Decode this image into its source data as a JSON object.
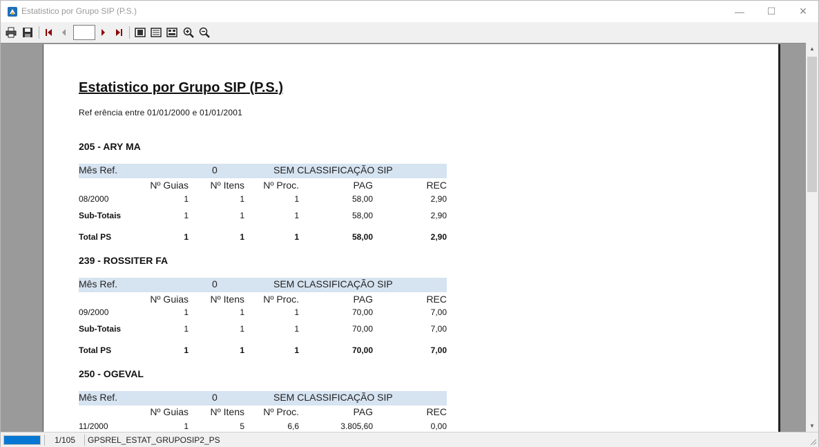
{
  "window": {
    "title": "Estatistico por Grupo SIP (P.S.)",
    "minimize_glyph": "—",
    "maximize_glyph": "☐",
    "close_glyph": "✕"
  },
  "toolbar": {
    "buttons": [
      "print-icon",
      "save-icon",
      "first-page-icon",
      "prev-page-icon",
      "next-page-icon",
      "last-page-icon",
      "whole-page-icon",
      "page-width-icon",
      "multiple-pages-icon",
      "zoom-in-icon",
      "zoom-out-icon"
    ],
    "page_value": ""
  },
  "report": {
    "title": "Estatistico por Grupo SIP (P.S.)",
    "subtitle": "Ref erência entre 01/01/2000 e 01/01/2001",
    "columns": {
      "guias": "Nº Guias",
      "itens": "Nº Itens",
      "proc": "Nº Proc.",
      "pag": "PAG",
      "rec": "REC"
    },
    "groups": [
      {
        "header": "205 - ARY MA",
        "band_label": "Mês Ref.",
        "band_code": "0",
        "band_desc": "SEM CLASSIFICAÇÃO SIP",
        "rows": [
          {
            "label": "08/2000",
            "guias": "1",
            "itens": "1",
            "proc": "1",
            "pag": "58,00",
            "rec": "2,90"
          },
          {
            "label": "Sub-Totais",
            "guias": "1",
            "itens": "1",
            "proc": "1",
            "pag": "58,00",
            "rec": "2,90"
          },
          {
            "label": "Total PS",
            "guias": "1",
            "itens": "1",
            "proc": "1",
            "pag": "58,00",
            "rec": "2,90"
          }
        ]
      },
      {
        "header": "239 - ROSSITER FA",
        "band_label": "Mês Ref.",
        "band_code": "0",
        "band_desc": "SEM CLASSIFICAÇÃO SIP",
        "rows": [
          {
            "label": "09/2000",
            "guias": "1",
            "itens": "1",
            "proc": "1",
            "pag": "70,00",
            "rec": "7,00"
          },
          {
            "label": "Sub-Totais",
            "guias": "1",
            "itens": "1",
            "proc": "1",
            "pag": "70,00",
            "rec": "7,00"
          },
          {
            "label": "Total PS",
            "guias": "1",
            "itens": "1",
            "proc": "1",
            "pag": "70,00",
            "rec": "7,00"
          }
        ]
      },
      {
        "header": "250 - OGEVAL",
        "band_label": "Mês Ref.",
        "band_code": "0",
        "band_desc": "SEM CLASSIFICAÇÃO SIP",
        "rows": [
          {
            "label": "11/2000",
            "guias": "1",
            "itens": "5",
            "proc": "6,6",
            "pag": "3.805,60",
            "rec": "0,00"
          }
        ]
      }
    ]
  },
  "status": {
    "progress_fraction": 1.0,
    "page_info": "1/105",
    "report_name": "GPSREL_ESTAT_GRUPOSIP2_PS"
  },
  "colors": {
    "band": "#d6e3f1",
    "progress": "#0678d4"
  }
}
